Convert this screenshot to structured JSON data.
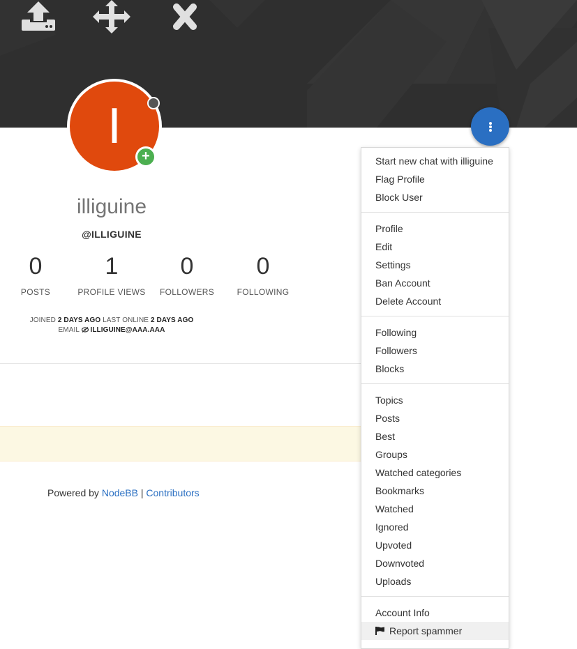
{
  "cover": {
    "buttons": [
      {
        "name": "upload-icon",
        "label": "upload"
      },
      {
        "name": "move-icon",
        "label": "move"
      },
      {
        "name": "remove-icon",
        "label": "remove"
      }
    ]
  },
  "profile": {
    "avatar_letter": "I",
    "avatar_color": "#e0490d",
    "fullname": "illiguine",
    "username": "@ILLIGUINE",
    "stats": [
      {
        "value": "0",
        "label": "POSTS"
      },
      {
        "value": "1",
        "label": "PROFILE VIEWS"
      },
      {
        "value": "0",
        "label": "FOLLOWERS"
      },
      {
        "value": "0",
        "label": "FOLLOWING"
      }
    ],
    "joined_label": "JOINED",
    "joined_value": "2 DAYS AGO",
    "last_online_label": "LAST ONLINE",
    "last_online_value": "2 DAYS AGO",
    "email_label": "EMAIL",
    "email_value": "ILLIGUINE@AAA.AAA"
  },
  "footer": {
    "powered_by": "Powered by",
    "nodebb": "NodeBB",
    "separator": "|",
    "contributors": "Contributors"
  },
  "menu": {
    "groups": [
      [
        "Start new chat with illiguine",
        "Flag Profile",
        "Block User"
      ],
      [
        "Profile",
        "Edit",
        "Settings",
        "Ban Account",
        "Delete Account"
      ],
      [
        "Following",
        "Followers",
        "Blocks"
      ],
      [
        "Topics",
        "Posts",
        "Best",
        "Groups",
        "Watched categories",
        "Bookmarks",
        "Watched",
        "Ignored",
        "Upvoted",
        "Downvoted",
        "Uploads"
      ],
      [
        "Account Info",
        "Report spammer"
      ]
    ],
    "highlighted": "Report spammer"
  },
  "colors": {
    "accent": "#2a6fc2",
    "cover": "#2f2f2f",
    "online_badge": "#4caf50"
  }
}
